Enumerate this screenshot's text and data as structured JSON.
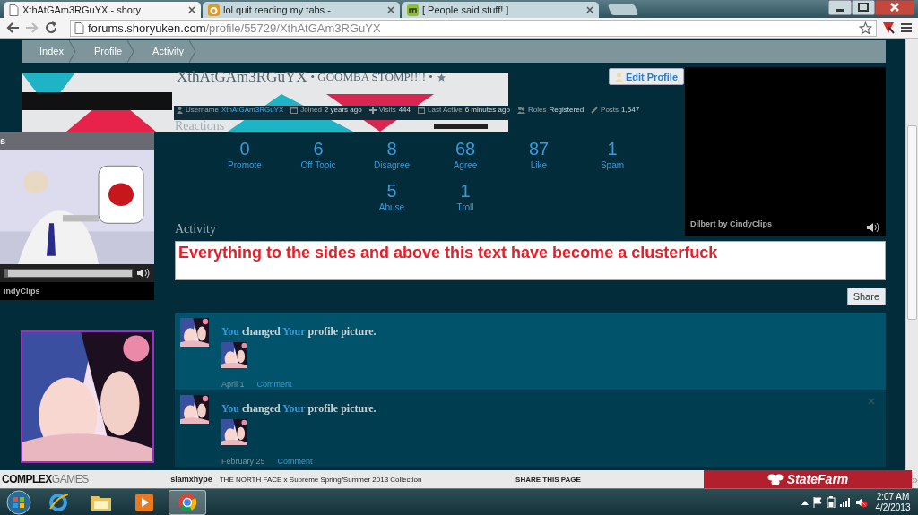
{
  "browser": {
    "tabs": [
      {
        "title": "XthAtGAm3RGuYX - shory",
        "selected": true
      },
      {
        "title": "lol quit reading my tabs -",
        "selected": false
      },
      {
        "title": "[ People said stuff! ]",
        "selected": false
      }
    ],
    "url": {
      "host": "forums.shoryuken.com",
      "path": "/profile/55729/XthAtGAm3RGuYX"
    }
  },
  "breadcrumbs": [
    "Index",
    "Profile",
    "Activity"
  ],
  "profile": {
    "name": "XthAtGAm3RGuYX",
    "tagline": "• GOOMBA STOMP!!!! •",
    "edit_button": "Edit Profile",
    "stats": [
      {
        "kind": "person",
        "label": "Username",
        "value": "XthAtGAm3RGuYX",
        "link": true
      },
      {
        "kind": "calendar",
        "label": "Joined",
        "value": "2 years ago",
        "link": false
      },
      {
        "kind": "plus",
        "label": "Visits",
        "value": "444",
        "link": false
      },
      {
        "kind": "calendar",
        "label": "Last Active",
        "value": "6 minutes ago",
        "link": false
      },
      {
        "kind": "people",
        "label": "Roles",
        "value": "Registered",
        "link": false
      },
      {
        "kind": "pencil",
        "label": "Posts",
        "value": "1,547",
        "link": false
      }
    ]
  },
  "reactions": {
    "heading": "Reactions",
    "items": [
      {
        "count": "0",
        "label": "Promote"
      },
      {
        "count": "6",
        "label": "Off Topic"
      },
      {
        "count": "8",
        "label": "Disagree"
      },
      {
        "count": "68",
        "label": "Agree"
      },
      {
        "count": "87",
        "label": "Like"
      },
      {
        "count": "1",
        "label": "Spam"
      },
      {
        "count": "5",
        "label": "Abuse"
      },
      {
        "count": "1",
        "label": "Troll"
      }
    ]
  },
  "left_video": {
    "title": "s",
    "caption": "indyClips",
    "level": 0.03
  },
  "right_video": {
    "caption": "Dilbert by CindyClips"
  },
  "activity": {
    "heading": "Activity",
    "input_value": "Everything to the sides and above this text have become a clusterfuck",
    "share_button": "Share",
    "items": [
      {
        "parts": [
          {
            "text": "You",
            "kind": "link"
          },
          {
            "text": " changed ",
            "kind": "text"
          },
          {
            "text": "Your",
            "kind": "link"
          },
          {
            "text": " profile picture.",
            "kind": "text"
          }
        ],
        "date": "April 1",
        "comment": "Comment",
        "highlighted": true,
        "show_close": false
      },
      {
        "parts": [
          {
            "text": "You",
            "kind": "link"
          },
          {
            "text": " changed ",
            "kind": "text"
          },
          {
            "text": "Your",
            "kind": "link"
          },
          {
            "text": " profile picture.",
            "kind": "text"
          }
        ],
        "date": "February 25",
        "comment": "Comment",
        "highlighted": false,
        "show_close": true
      }
    ]
  },
  "bottom_bar": {
    "logo": "**COMPLEX**GAMES",
    "user": "slamxhype",
    "headline": "THE NORTH FACE x Supreme Spring/Summer 2013 Collection",
    "share": "SHARE THIS PAGE",
    "sponsor": "StateFarm",
    "more": "»"
  },
  "taskbar": {
    "apps": [
      {
        "kind": "ie",
        "active": false
      },
      {
        "kind": "folder",
        "active": false
      },
      {
        "kind": "media",
        "active": false
      },
      {
        "kind": "chrome",
        "active": true
      }
    ],
    "time": "2:07 AM",
    "date": "4/2/2013"
  }
}
